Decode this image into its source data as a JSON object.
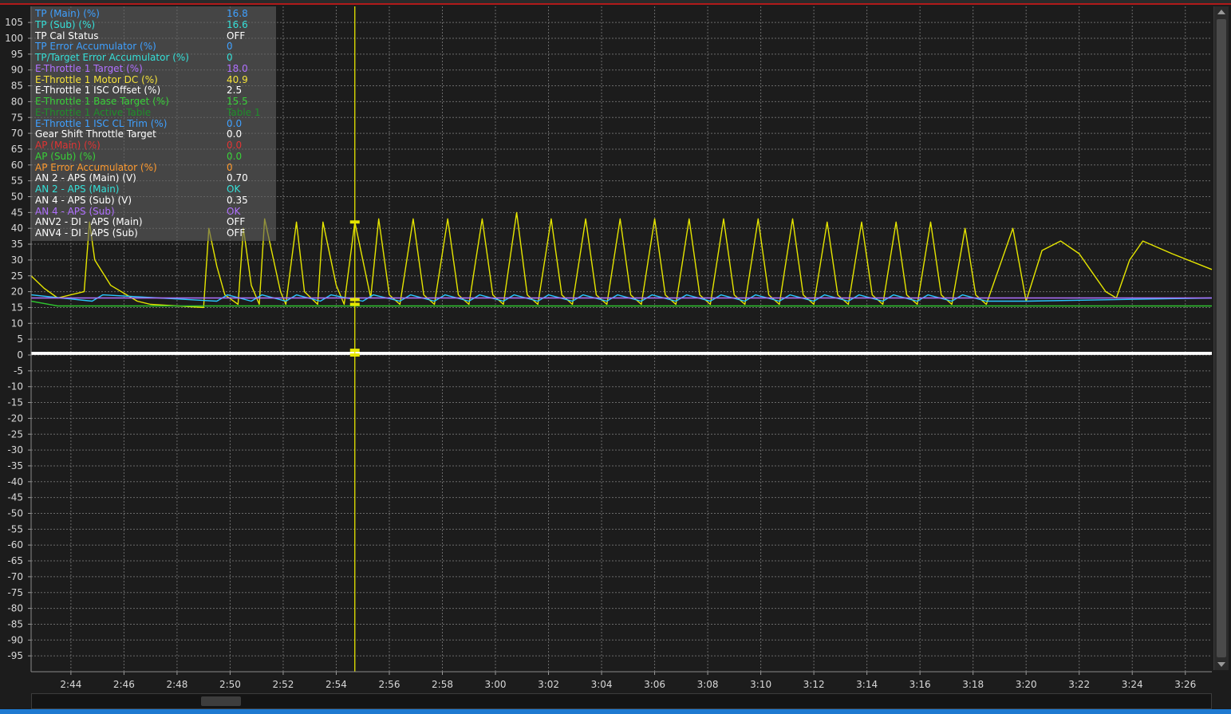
{
  "colors": {
    "background": "#1c1c1c",
    "grid": "#6a6a6a",
    "cursor": "#e6e600",
    "trace_yellow": "#e6e600",
    "trace_cyan": "#29c6ff",
    "trace_purple": "#b070ff",
    "trace_green": "#2fc52f",
    "trace_white": "#ffffff"
  },
  "cursor_time": "2:54.7",
  "legend": {
    "items": [
      {
        "label": "TP (Main) (%)",
        "value": "16.8",
        "color": "#3fa0ff"
      },
      {
        "label": "TP (Sub) (%)",
        "value": "16.6",
        "color": "#35e0d8"
      },
      {
        "label": "TP Cal Status",
        "value": "OFF",
        "color": "#ffffff"
      },
      {
        "label": "TP Error Accumulator (%)",
        "value": "0",
        "color": "#3fa0ff"
      },
      {
        "label": "TP/Target Error Accumulator (%)",
        "value": "0",
        "color": "#35e0d8"
      },
      {
        "label": "E-Throttle 1 Target (%)",
        "value": "18.0",
        "color": "#b070ff"
      },
      {
        "label": "E-Throttle 1 Motor DC (%)",
        "value": "40.9",
        "color": "#f5e23a"
      },
      {
        "label": "E-Throttle 1 ISC Offset (%)",
        "value": "2.5",
        "color": "#ffffff"
      },
      {
        "label": "E-Throttle 1 Base Target  (%)",
        "value": "15.5",
        "color": "#38d038"
      },
      {
        "label": "E-Throttle 1 Active Table",
        "value": "Table 1",
        "color": "#1f8f2a"
      },
      {
        "label": "E-Throttle 1 ISC CL Trim (%)",
        "value": "0.0",
        "color": "#3fa0ff"
      },
      {
        "label": "Gear Shift Throttle Target",
        "value": "0.0",
        "color": "#ffffff"
      },
      {
        "label": "AP (Main) (%)",
        "value": "0.0",
        "color": "#e03434"
      },
      {
        "label": "AP (Sub) (%)",
        "value": "0.0",
        "color": "#38d038"
      },
      {
        "label": "AP Error Accumulator (%)",
        "value": "0",
        "color": "#ff9a2e"
      },
      {
        "label": "AN 2 - APS (Main) (V)",
        "value": "0.70",
        "color": "#ffffff"
      },
      {
        "label": "AN 2 - APS (Main)",
        "value": "OK",
        "color": "#35e0d8"
      },
      {
        "label": "AN 4 - APS (Sub) (V)",
        "value": "0.35",
        "color": "#ffffff"
      },
      {
        "label": "AN 4 - APS (Sub)",
        "value": "OK",
        "color": "#b070ff"
      },
      {
        "label": "ANV2 - DI - APS (Main)",
        "value": "OFF",
        "color": "#ffffff"
      },
      {
        "label": "ANV4 - DI - APS (Sub)",
        "value": "OFF",
        "color": "#ffffff"
      }
    ]
  },
  "chart_data": {
    "type": "line",
    "title": "",
    "xlabel": "",
    "ylabel": "",
    "ylim": [
      -100,
      110
    ],
    "xlim": [
      "2:42.5",
      "3:27.0"
    ],
    "grid": true,
    "legend_position": "top-left",
    "y_ticks": [
      "105",
      "100",
      "95",
      "90",
      "85",
      "80",
      "75",
      "70",
      "65",
      "60",
      "55",
      "50",
      "45",
      "40",
      "35",
      "30",
      "25",
      "20",
      "15",
      "10",
      "5",
      "0",
      "-5",
      "-10",
      "-15",
      "-20",
      "-25",
      "-30",
      "-35",
      "-40",
      "-45",
      "-50",
      "-55",
      "-60",
      "-65",
      "-70",
      "-75",
      "-80",
      "-85",
      "-90",
      "-95"
    ],
    "x_ticks": [
      "2:44",
      "2:46",
      "2:48",
      "2:50",
      "2:52",
      "2:54",
      "2:56",
      "2:58",
      "3:00",
      "3:02",
      "3:04",
      "3:06",
      "3:08",
      "3:10",
      "3:12",
      "3:14",
      "3:16",
      "3:18",
      "3:20",
      "3:22",
      "3:24",
      "3:26"
    ],
    "series": [
      {
        "color": "#e6e600",
        "x": [
          "2:42.5",
          "2:43.0",
          "2:43.5",
          "2:44.5",
          "2:44.7",
          "2:44.9",
          "2:45.5",
          "2:46.5",
          "2:47.0",
          "2:49.0",
          "2:49.2",
          "2:49.5",
          "2:49.8",
          "2:50.3",
          "2:50.5",
          "2:50.8",
          "2:51.1",
          "2:51.3",
          "2:51.9",
          "2:52.1",
          "2:52.5",
          "2:52.8",
          "2:53.3",
          "2:53.5",
          "2:54.0",
          "2:54.3",
          "2:54.7",
          "2:55.3",
          "2:55.6",
          "2:56.0",
          "2:56.4",
          "2:56.9",
          "2:57.3",
          "2:57.7",
          "2:58.2",
          "2:58.6",
          "2:59.0",
          "2:59.5",
          "2:59.9",
          "3:00.3",
          "3:00.8",
          "3:01.2",
          "3:01.6",
          "3:02.1",
          "3:02.5",
          "3:02.9",
          "3:03.4",
          "3:03.8",
          "3:04.2",
          "3:04.7",
          "3:05.1",
          "3:05.5",
          "3:06.0",
          "3:06.4",
          "3:06.8",
          "3:07.3",
          "3:07.7",
          "3:08.1",
          "3:08.6",
          "3:09.0",
          "3:09.4",
          "3:09.9",
          "3:10.3",
          "3:10.7",
          "3:11.2",
          "3:11.6",
          "3:12.0",
          "3:12.5",
          "3:12.9",
          "3:13.3",
          "3:13.8",
          "3:14.2",
          "3:14.6",
          "3:15.1",
          "3:15.5",
          "3:15.9",
          "3:16.4",
          "3:16.8",
          "3:17.2",
          "3:17.7",
          "3:18.1",
          "3:18.5",
          "3:19.5",
          "3:20.0",
          "3:20.6",
          "3:21.3",
          "3:22.0",
          "3:22.5",
          "3:23.0",
          "3:23.4",
          "3:23.9",
          "3:24.4",
          "3:25.5",
          "3:27.0"
        ],
        "values": [
          25,
          21,
          18,
          20,
          42,
          30,
          22,
          17,
          16,
          15,
          40,
          28,
          19,
          16,
          40,
          22,
          16,
          43,
          20,
          16,
          42,
          20,
          16,
          42,
          22,
          16,
          42,
          18,
          43,
          19,
          16,
          43,
          19,
          16,
          43,
          19,
          16,
          43,
          19,
          16,
          45,
          19,
          16,
          43,
          19,
          16,
          43,
          19,
          16,
          43,
          19,
          16,
          43,
          19,
          16,
          43,
          19,
          16,
          43,
          19,
          16,
          43,
          19,
          16,
          43,
          19,
          16,
          42,
          19,
          16,
          42,
          19,
          16,
          42,
          19,
          16,
          42,
          19,
          16,
          40,
          19,
          16,
          40,
          17,
          33,
          36,
          32,
          26,
          20,
          18,
          30,
          36,
          32,
          27
        ]
      },
      {
        "color": "#29c6ff",
        "x": [
          "2:42.5",
          "2:44.8",
          "2:45.2",
          "2:49.5",
          "2:49.9",
          "2:50.8",
          "2:51.2",
          "2:52.1",
          "2:52.5",
          "2:53.4",
          "2:53.8",
          "2:55.0",
          "2:55.4",
          "2:56.4",
          "2:56.8",
          "2:57.7",
          "2:58.1",
          "2:59.0",
          "2:59.4",
          "3:00.3",
          "3:00.7",
          "3:01.6",
          "3:02.0",
          "3:02.9",
          "3:03.3",
          "3:04.2",
          "3:04.6",
          "3:05.5",
          "3:05.9",
          "3:06.8",
          "3:07.2",
          "3:08.1",
          "3:08.5",
          "3:09.4",
          "3:09.8",
          "3:10.7",
          "3:11.1",
          "3:12.0",
          "3:12.4",
          "3:13.3",
          "3:13.7",
          "3:14.6",
          "3:15.0",
          "3:15.9",
          "3:16.3",
          "3:17.2",
          "3:17.6",
          "3:18.5",
          "3:20.0",
          "3:27.0"
        ],
        "values": [
          19,
          17,
          19,
          17,
          19,
          17,
          19,
          17,
          19,
          17,
          19,
          17,
          19,
          17,
          19,
          17,
          19,
          17,
          19,
          17,
          19,
          17,
          19,
          17,
          19,
          17,
          19,
          17,
          19,
          17,
          19,
          17,
          19,
          17,
          19,
          17,
          19,
          17,
          19,
          17,
          19,
          17,
          19,
          17,
          19,
          17,
          19,
          17,
          17,
          18
        ]
      },
      {
        "color": "#b070ff",
        "x": [
          "2:42.5",
          "3:27.0"
        ],
        "values": [
          18,
          18
        ]
      },
      {
        "color": "#2fc52f",
        "x": [
          "2:42.5",
          "2:43.5",
          "3:27.0"
        ],
        "values": [
          17,
          15.5,
          15.5
        ]
      },
      {
        "color": "#ffffff",
        "x": [
          "2:42.5",
          "3:27.0"
        ],
        "values": [
          0.7,
          0.7
        ]
      },
      {
        "color": "#ffffff",
        "x": [
          "2:42.5",
          "3:27.0"
        ],
        "values": [
          0.35,
          0.35
        ]
      }
    ]
  }
}
